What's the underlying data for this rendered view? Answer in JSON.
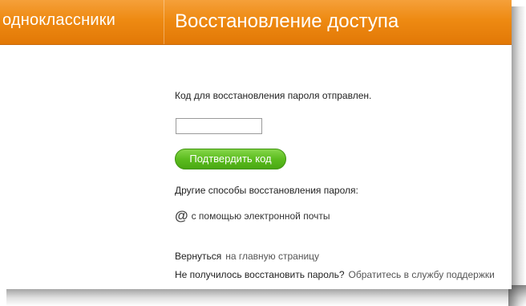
{
  "header": {
    "logo_text": "одноклассники",
    "title": "Восстановление доступа"
  },
  "main": {
    "message": "Код для восстановления пароля отправлен.",
    "code_input": {
      "value": "",
      "placeholder": ""
    },
    "confirm_button_label": "Подтвердить код",
    "other_methods_label": "Другие способы восстановления пароля:",
    "email_method": {
      "icon": "@",
      "label": "с помощью электронной почты"
    },
    "return": {
      "prefix": "Вернуться",
      "link": "на главную страницу"
    },
    "failed": {
      "question": "Не получилось восстановить пароль?",
      "link": "Обратитесь в службу поддержки"
    }
  },
  "colors": {
    "header_orange": "#ee8a12",
    "button_green": "#5cbd1f"
  }
}
